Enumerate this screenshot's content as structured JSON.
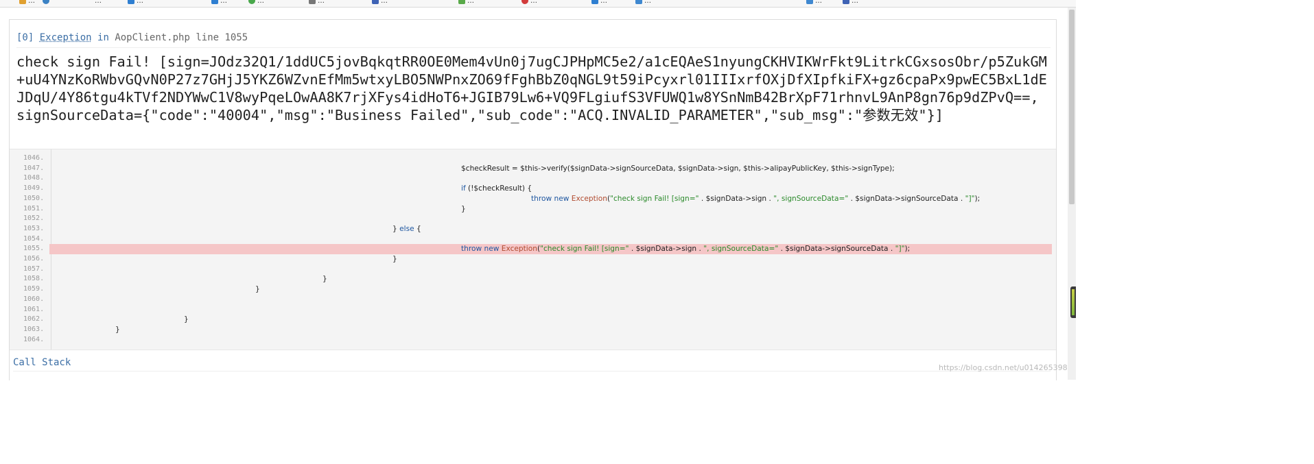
{
  "exception": {
    "index": "[0]",
    "class_name": "Exception",
    "in_word": "in",
    "location": "AopClient.php line 1055",
    "message": "check sign Fail! [sign=JOdz32Q1/1ddUC5jovBqkqtRR0OE0Mem4vUn0j7ugCJPHpMC5e2/a1cEQAeS1nyungCKHVIKWrFkt9LitrkCGxsosObr/p5ZukGM+uU4YNzKoRWbvGQvN0P27z7GHjJ5YKZ6WZvnEfMm5wtxyLBO5NWPnxZO69fFghBbZ0qNGL9t59iPcyxrl01IIIxrfOXjDfXIpfkiFX+gz6cpaPx9pwEC5BxL1dEJDqU/4Y86tgu4kTVf2NDYWwC1V8wyPqeLOwAA8K7rjXFys4idHoT6+JGIB79Lw6+VQ9FLgiufS3VFUWQ1w8YSnNmB42BrXpF71rhnvL9AnP8gn76p9dZPvQ==, signSourceData={\"code\":\"40004\",\"msg\":\"Business Failed\",\"sub_code\":\"ACQ.INVALID_PARAMETER\",\"sub_msg\":\"参数无效\"}]"
  },
  "code": {
    "lines": [
      {
        "num": "1046.",
        "text": ""
      },
      {
        "num": "1047.",
        "text": "$checkResult = $this->verify($signData->signSourceData, $signData->sign, $this->alipayPublicKey, $this->signType);"
      },
      {
        "num": "1048.",
        "text": ""
      },
      {
        "num": "1049.",
        "text": "if (!$checkResult) {"
      },
      {
        "num": "1050.",
        "text": "throw new Exception(\"check sign Fail! [sign=\" . $signData->sign . \", signSourceData=\" . $signData->signSourceData . \"]\");"
      },
      {
        "num": "1051.",
        "text": "}"
      },
      {
        "num": "1052.",
        "text": ""
      },
      {
        "num": "1053.",
        "text": "} else {"
      },
      {
        "num": "1054.",
        "text": ""
      },
      {
        "num": "1055.",
        "text": "throw new Exception(\"check sign Fail! [sign=\" . $signData->sign . \", signSourceData=\" . $signData->signSourceData . \"]\");"
      },
      {
        "num": "1056.",
        "text": "}"
      },
      {
        "num": "1057.",
        "text": ""
      },
      {
        "num": "1058.",
        "text": "}"
      },
      {
        "num": "1059.",
        "text": "}"
      },
      {
        "num": "1060.",
        "text": ""
      },
      {
        "num": "1061.",
        "text": ""
      },
      {
        "num": "1062.",
        "text": "}"
      },
      {
        "num": "1063.",
        "text": "}"
      },
      {
        "num": "1064.",
        "text": ""
      }
    ],
    "highlight_line": "1055.",
    "highlight_color": "#f5c6c7"
  },
  "call_stack_label": "Call Stack",
  "watermark": "https://blog.csdn.net/u014265398",
  "bookmarks": [
    {
      "label": "…",
      "color": "#e0a030"
    },
    {
      "label": "…",
      "color": "#3b82c4"
    },
    {
      "label": "…",
      "color": "#4caf50"
    },
    {
      "label": "…",
      "color": "#2f7fd1"
    },
    {
      "label": "…",
      "color": "#49a84b"
    },
    {
      "label": "…",
      "color": "#777777"
    },
    {
      "label": "…",
      "color": "#3f63b5"
    },
    {
      "label": "…",
      "color": "#5aaa4a"
    },
    {
      "label": "…",
      "color": "#d23b3b"
    },
    {
      "label": "…",
      "color": "#2f7fd1"
    },
    {
      "label": "…",
      "color": "#3f88d0"
    },
    {
      "label": "…",
      "color": "#3f88d0"
    },
    {
      "label": "…",
      "color": "#3f63b5"
    }
  ],
  "colors": {
    "link": "#3b6ea5",
    "keyword": "#1e56a0",
    "string": "#2b8a2b",
    "code_bg": "#f4f4f4"
  }
}
